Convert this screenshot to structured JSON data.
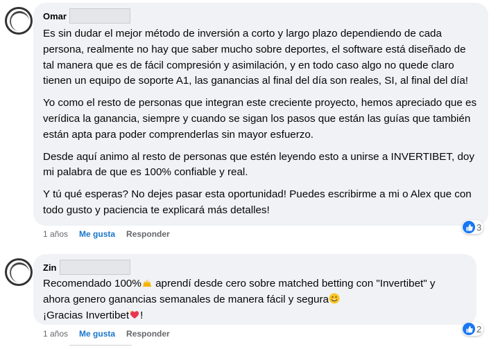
{
  "comments": [
    {
      "author": "Omar",
      "paragraphs": [
        "Es sin dudar el mejor método de inversión a corto y largo plazo dependiendo de cada persona, realmente no hay que saber mucho sobre deportes, el software está diseñado de tal manera que es de fácil compresión y asimilación, y en todo caso algo no quede claro tienen un equipo de soporte A1, las ganancias al final del día son reales, SI, al final del día!",
        "Yo como el resto de personas que integran este creciente proyecto, hemos apreciado que es verídica la ganancia, siempre y cuando se sigan los pasos que están las guías que también están apta para poder comprenderlas sin mayor esfuerzo.",
        "Desde aquí animo al resto de personas que estén leyendo esto a unirse a INVERTIBET, doy mi palabra de que es 100% confiable y real.",
        "Y tú qué esperas? No dejes pasar esta oportunidad! Puedes escribirme a mi o Alex que con todo gusto y paciencia te explicará más detalles!"
      ],
      "time": "1 años",
      "like_label": "Me gusta",
      "reply_label": "Responder",
      "reaction_count": "3",
      "reaction_icon": "thumbs-up-icon"
    },
    {
      "author": "Zin",
      "line1_a": "Recomendado 100%",
      "line1_b": " aprendí desde cero sobre matched betting con \"Invertibet\" y",
      "line2": "ahora genero ganancias semanales de manera fácil y segura",
      "line3": "¡Gracias Invertibet",
      "line3_end": "!",
      "time": "1 años",
      "like_label": "Me gusta",
      "reply_label": "Responder",
      "reaction_count": "2",
      "reaction_icon": "thumbs-up-icon"
    }
  ],
  "colors": {
    "bubble": "#f0f2f5",
    "like_blue": "#1877f2",
    "meta_gray": "#65676b"
  }
}
